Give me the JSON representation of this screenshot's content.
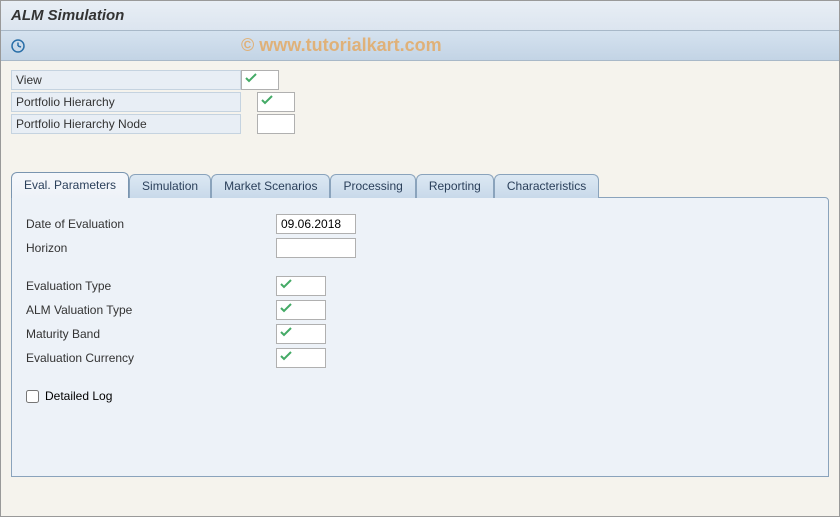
{
  "window": {
    "title": "ALM Simulation"
  },
  "watermark": "© www.tutorialkart.com",
  "toolbar": {
    "execute_icon": "execute-icon"
  },
  "top_form": {
    "view_label": "View",
    "view_value": "",
    "portfolio_hierarchy_label": "Portfolio Hierarchy",
    "portfolio_hierarchy_value": "",
    "portfolio_node_label": "Portfolio Hierarchy Node",
    "portfolio_node_value": ""
  },
  "tabs": {
    "eval_params": "Eval. Parameters",
    "simulation": "Simulation",
    "market_scenarios": "Market Scenarios",
    "processing": "Processing",
    "reporting": "Reporting",
    "characteristics": "Characteristics"
  },
  "eval_panel": {
    "date_label": "Date of Evaluation",
    "date_value": "09.06.2018",
    "horizon_label": "Horizon",
    "horizon_value": "",
    "eval_type_label": "Evaluation Type",
    "eval_type_value": "",
    "alm_valuation_label": "ALM Valuation Type",
    "alm_valuation_value": "",
    "maturity_band_label": "Maturity Band",
    "maturity_band_value": "",
    "eval_currency_label": "Evaluation Currency",
    "eval_currency_value": "",
    "detailed_log_label": "Detailed Log",
    "detailed_log_checked": false
  }
}
